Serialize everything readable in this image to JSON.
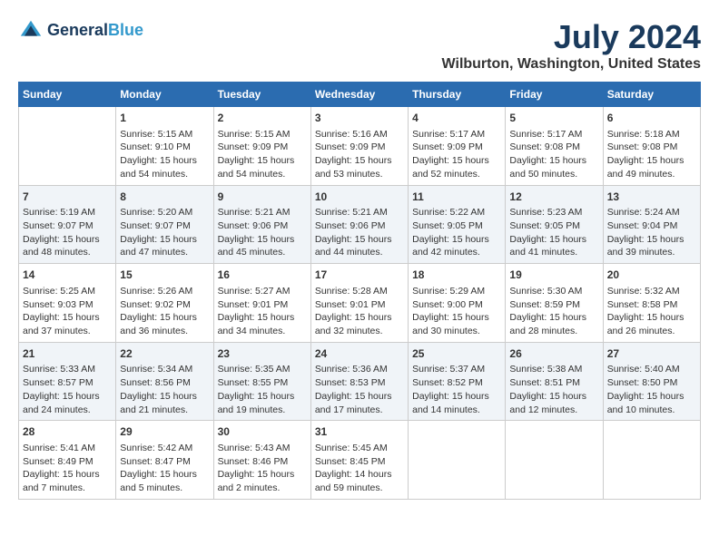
{
  "header": {
    "logo_line1": "General",
    "logo_line2": "Blue",
    "main_title": "July 2024",
    "subtitle": "Wilburton, Washington, United States"
  },
  "calendar": {
    "days_of_week": [
      "Sunday",
      "Monday",
      "Tuesday",
      "Wednesday",
      "Thursday",
      "Friday",
      "Saturday"
    ],
    "weeks": [
      [
        {
          "day": "",
          "content": ""
        },
        {
          "day": "1",
          "content": "Sunrise: 5:15 AM\nSunset: 9:10 PM\nDaylight: 15 hours\nand 54 minutes."
        },
        {
          "day": "2",
          "content": "Sunrise: 5:15 AM\nSunset: 9:09 PM\nDaylight: 15 hours\nand 54 minutes."
        },
        {
          "day": "3",
          "content": "Sunrise: 5:16 AM\nSunset: 9:09 PM\nDaylight: 15 hours\nand 53 minutes."
        },
        {
          "day": "4",
          "content": "Sunrise: 5:17 AM\nSunset: 9:09 PM\nDaylight: 15 hours\nand 52 minutes."
        },
        {
          "day": "5",
          "content": "Sunrise: 5:17 AM\nSunset: 9:08 PM\nDaylight: 15 hours\nand 50 minutes."
        },
        {
          "day": "6",
          "content": "Sunrise: 5:18 AM\nSunset: 9:08 PM\nDaylight: 15 hours\nand 49 minutes."
        }
      ],
      [
        {
          "day": "7",
          "content": "Sunrise: 5:19 AM\nSunset: 9:07 PM\nDaylight: 15 hours\nand 48 minutes."
        },
        {
          "day": "8",
          "content": "Sunrise: 5:20 AM\nSunset: 9:07 PM\nDaylight: 15 hours\nand 47 minutes."
        },
        {
          "day": "9",
          "content": "Sunrise: 5:21 AM\nSunset: 9:06 PM\nDaylight: 15 hours\nand 45 minutes."
        },
        {
          "day": "10",
          "content": "Sunrise: 5:21 AM\nSunset: 9:06 PM\nDaylight: 15 hours\nand 44 minutes."
        },
        {
          "day": "11",
          "content": "Sunrise: 5:22 AM\nSunset: 9:05 PM\nDaylight: 15 hours\nand 42 minutes."
        },
        {
          "day": "12",
          "content": "Sunrise: 5:23 AM\nSunset: 9:05 PM\nDaylight: 15 hours\nand 41 minutes."
        },
        {
          "day": "13",
          "content": "Sunrise: 5:24 AM\nSunset: 9:04 PM\nDaylight: 15 hours\nand 39 minutes."
        }
      ],
      [
        {
          "day": "14",
          "content": "Sunrise: 5:25 AM\nSunset: 9:03 PM\nDaylight: 15 hours\nand 37 minutes."
        },
        {
          "day": "15",
          "content": "Sunrise: 5:26 AM\nSunset: 9:02 PM\nDaylight: 15 hours\nand 36 minutes."
        },
        {
          "day": "16",
          "content": "Sunrise: 5:27 AM\nSunset: 9:01 PM\nDaylight: 15 hours\nand 34 minutes."
        },
        {
          "day": "17",
          "content": "Sunrise: 5:28 AM\nSunset: 9:01 PM\nDaylight: 15 hours\nand 32 minutes."
        },
        {
          "day": "18",
          "content": "Sunrise: 5:29 AM\nSunset: 9:00 PM\nDaylight: 15 hours\nand 30 minutes."
        },
        {
          "day": "19",
          "content": "Sunrise: 5:30 AM\nSunset: 8:59 PM\nDaylight: 15 hours\nand 28 minutes."
        },
        {
          "day": "20",
          "content": "Sunrise: 5:32 AM\nSunset: 8:58 PM\nDaylight: 15 hours\nand 26 minutes."
        }
      ],
      [
        {
          "day": "21",
          "content": "Sunrise: 5:33 AM\nSunset: 8:57 PM\nDaylight: 15 hours\nand 24 minutes."
        },
        {
          "day": "22",
          "content": "Sunrise: 5:34 AM\nSunset: 8:56 PM\nDaylight: 15 hours\nand 21 minutes."
        },
        {
          "day": "23",
          "content": "Sunrise: 5:35 AM\nSunset: 8:55 PM\nDaylight: 15 hours\nand 19 minutes."
        },
        {
          "day": "24",
          "content": "Sunrise: 5:36 AM\nSunset: 8:53 PM\nDaylight: 15 hours\nand 17 minutes."
        },
        {
          "day": "25",
          "content": "Sunrise: 5:37 AM\nSunset: 8:52 PM\nDaylight: 15 hours\nand 14 minutes."
        },
        {
          "day": "26",
          "content": "Sunrise: 5:38 AM\nSunset: 8:51 PM\nDaylight: 15 hours\nand 12 minutes."
        },
        {
          "day": "27",
          "content": "Sunrise: 5:40 AM\nSunset: 8:50 PM\nDaylight: 15 hours\nand 10 minutes."
        }
      ],
      [
        {
          "day": "28",
          "content": "Sunrise: 5:41 AM\nSunset: 8:49 PM\nDaylight: 15 hours\nand 7 minutes."
        },
        {
          "day": "29",
          "content": "Sunrise: 5:42 AM\nSunset: 8:47 PM\nDaylight: 15 hours\nand 5 minutes."
        },
        {
          "day": "30",
          "content": "Sunrise: 5:43 AM\nSunset: 8:46 PM\nDaylight: 15 hours\nand 2 minutes."
        },
        {
          "day": "31",
          "content": "Sunrise: 5:45 AM\nSunset: 8:45 PM\nDaylight: 14 hours\nand 59 minutes."
        },
        {
          "day": "",
          "content": ""
        },
        {
          "day": "",
          "content": ""
        },
        {
          "day": "",
          "content": ""
        }
      ]
    ]
  }
}
